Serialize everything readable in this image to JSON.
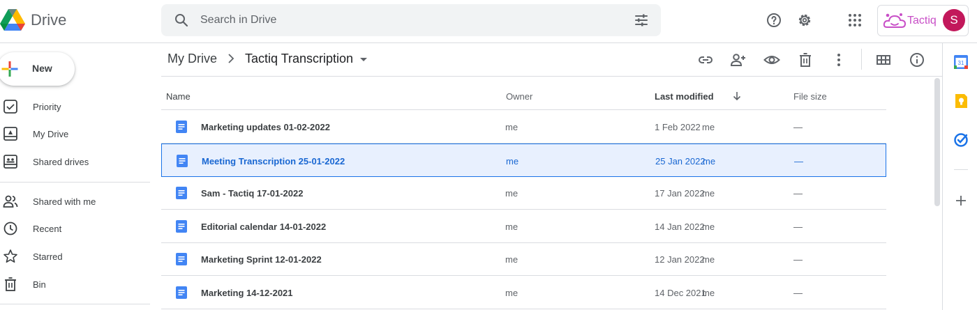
{
  "app": {
    "name": "Drive"
  },
  "search": {
    "placeholder": "Search in Drive"
  },
  "header_icons": [
    "help-icon",
    "settings-icon",
    "apps-grid-icon"
  ],
  "tactiq": {
    "label": "Tactiq",
    "color": "#c84fc7"
  },
  "account": {
    "initial": "S",
    "color": "#c2185b"
  },
  "sidebar": {
    "new_label": "New",
    "items": [
      {
        "label": "Priority",
        "icon": "priority-check-icon"
      },
      {
        "label": "My Drive",
        "icon": "my-drive-icon"
      },
      {
        "label": "Shared drives",
        "icon": "shared-drives-icon"
      },
      {
        "label": "Shared with me",
        "icon": "people-icon"
      },
      {
        "label": "Recent",
        "icon": "clock-icon"
      },
      {
        "label": "Starred",
        "icon": "star-icon"
      },
      {
        "label": "Bin",
        "icon": "bin-icon"
      }
    ]
  },
  "breadcrumb": {
    "root": "My Drive",
    "current": "Tactiq Transcription"
  },
  "toolbar_icons": [
    "link-icon",
    "add-person-icon",
    "preview-eye-icon",
    "trash-icon",
    "more-vert-icon",
    "grid-view-icon",
    "info-icon"
  ],
  "table": {
    "headers": {
      "name": "Name",
      "owner": "Owner",
      "last_modified": "Last modified",
      "file_size": "File size"
    },
    "rows": [
      {
        "name": "Marketing updates 01-02-2022",
        "owner": "me",
        "date": "1 Feb 2022",
        "by": "me",
        "size": "—",
        "selected": false
      },
      {
        "name": "Meeting Transcription 25-01-2022",
        "owner": "me",
        "date": "25 Jan 2022",
        "by": "me",
        "size": "—",
        "selected": true
      },
      {
        "name": "Sam - Tactiq 17-01-2022",
        "owner": "me",
        "date": "17 Jan 2022",
        "by": "me",
        "size": "—",
        "selected": false
      },
      {
        "name": "Editorial calendar 14-01-2022",
        "owner": "me",
        "date": "14 Jan 2022",
        "by": "me",
        "size": "—",
        "selected": false
      },
      {
        "name": "Marketing Sprint 12-01-2022",
        "owner": "me",
        "date": "12 Jan 2022",
        "by": "me",
        "size": "—",
        "selected": false
      },
      {
        "name": "Marketing 14-12-2021",
        "owner": "me",
        "date": "14 Dec 2021",
        "by": "me",
        "size": "—",
        "selected": false
      }
    ]
  },
  "side_panel": {
    "calendar_day": "31",
    "icons": [
      "calendar-icon",
      "keep-icon",
      "tasks-icon",
      "add-addon-icon"
    ]
  },
  "colors": {
    "accent": "#1a73e8",
    "selected_bg": "#e8f0fe",
    "doc_blue": "#4285f4"
  }
}
